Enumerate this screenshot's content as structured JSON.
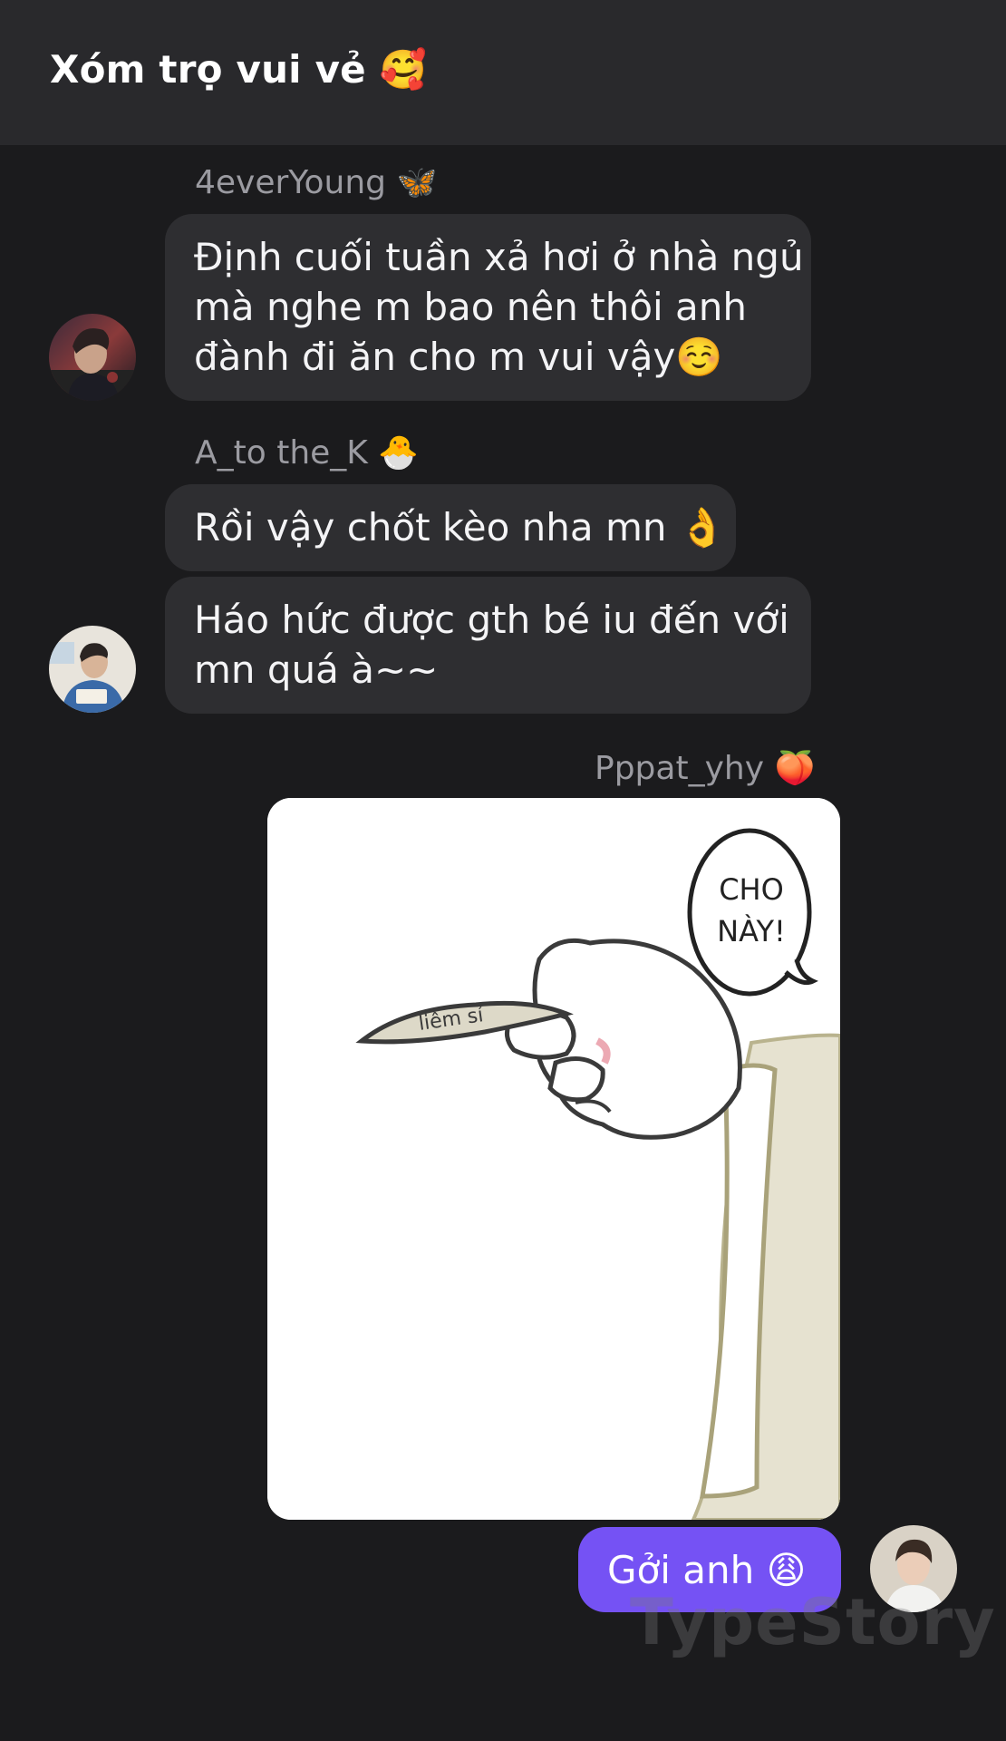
{
  "header": {
    "title": "Xóm trọ vui vẻ 🥰"
  },
  "messages": [
    {
      "sender": "4everYoung 🦋",
      "lines": [
        "Định cuối tuần xả hơi ở nhà ngủ",
        "mà nghe m bao nên thôi anh",
        "đành đi ăn cho m vui vậy☺️"
      ]
    },
    {
      "sender": "A_to the_K 🐣",
      "lines": [
        "Rồi vậy chốt kèo nha mn 👌"
      ]
    },
    {
      "lines": [
        "Háo hức được gth bé iu đến với",
        "mn quá à~~"
      ]
    },
    {
      "sender": "Pppat_yhy 🍑",
      "image": {
        "speech_lines": [
          "CHO",
          "NÀY!"
        ],
        "coin_text": "liêm sỉ"
      }
    },
    {
      "lines": [
        "Gởi anh 😩"
      ],
      "outgoing": true
    }
  ],
  "watermark": "TypeStory",
  "colors": {
    "background": "#1b1b1d",
    "header": "#29292c",
    "bubble_incoming": "#2e2e31",
    "bubble_outgoing": "#7552f4",
    "sender_name": "#9b9ba1"
  },
  "icons": {
    "avatar_1": "avatar-young-man-dark-stage",
    "avatar_2": "avatar-man-blue-shirt-reading",
    "avatar_3": "avatar-young-man-light-background"
  }
}
